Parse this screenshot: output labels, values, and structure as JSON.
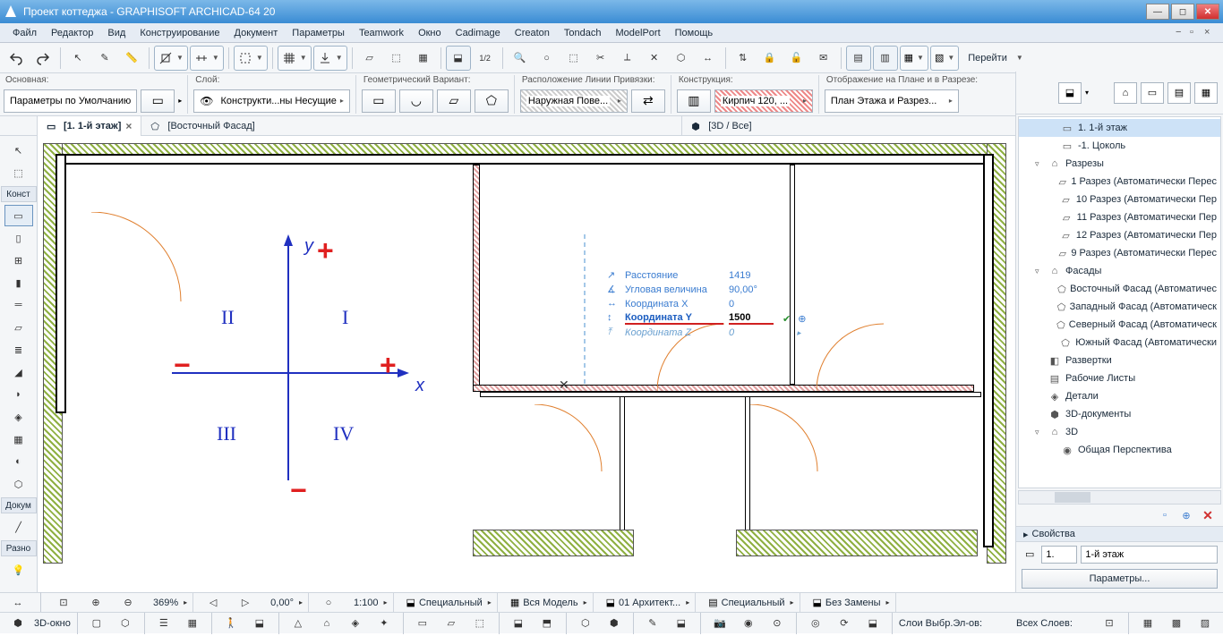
{
  "title": "Проект коттеджа - GRAPHISOFT ARCHICAD-64 20",
  "menu": [
    "Файл",
    "Редактор",
    "Вид",
    "Конструирование",
    "Документ",
    "Параметры",
    "Teamwork",
    "Окно",
    "Cadimage",
    "Creaton",
    "Tondach",
    "ModelPort",
    "Помощь"
  ],
  "go_label": "Перейти",
  "infobar": {
    "main": {
      "label": "Основная:",
      "value": "Параметры по Умолчанию"
    },
    "layer": {
      "label": "Слой:",
      "value": "Конструкти...ны Несущие"
    },
    "geom": {
      "label": "Геометрический Вариант:"
    },
    "snapline": {
      "label": "Расположение Линии Привязки:",
      "value": "Наружная Пове..."
    },
    "construct": {
      "label": "Конструкция:",
      "value": "Кирпич 120, ..."
    },
    "display": {
      "label": "Отображение на Плане и в Разрезе:",
      "value": "План Этажа и Разрез..."
    }
  },
  "tabs": [
    {
      "label": "[1. 1-й этаж]",
      "active": true,
      "icon": "plan-icon"
    },
    {
      "label": "[Восточный Фасад]",
      "active": false,
      "icon": "elev-icon"
    },
    {
      "label": "[3D / Все]",
      "active": false,
      "icon": "cube-icon"
    }
  ],
  "toolbox_groups": [
    "Конст",
    "Докум",
    "Разно"
  ],
  "canvas_labels": {
    "y": "y",
    "x": "x",
    "q1": "I",
    "q2": "II",
    "q3": "III",
    "q4": "IV"
  },
  "tracker": {
    "dist": {
      "label": "Расстояние",
      "val": "1419"
    },
    "ang": {
      "label": "Угловая величина",
      "val": "90,00°"
    },
    "cx": {
      "label": "Координата X",
      "val": "0"
    },
    "cy": {
      "label": "Координата Y",
      "val": "1500"
    },
    "cz": {
      "label": "Координата Z",
      "val": "0"
    }
  },
  "status1": {
    "zoom": "369%",
    "angle": "0,00°",
    "scale": "1:100",
    "spec1": "Специальный",
    "model": "Вся Модель",
    "arch": "01 Архитект...",
    "spec2": "Специальный",
    "nozam": "Без Замены"
  },
  "status2": {
    "win3d": "3D-окно",
    "layers_sel": "Слои Выбр.Эл-ов:",
    "layers_all": "Всех Слоев:"
  },
  "navigator": {
    "tree": [
      {
        "indent": 2,
        "icon": "floor",
        "label": "1. 1-й этаж",
        "sel": true
      },
      {
        "indent": 2,
        "icon": "floor",
        "label": "-1. Цоколь"
      },
      {
        "indent": 1,
        "icon": "folder",
        "label": "Разрезы",
        "toggle": "▿"
      },
      {
        "indent": 2,
        "icon": "sect",
        "label": "1 Разрез (Автоматически Перес"
      },
      {
        "indent": 2,
        "icon": "sect",
        "label": "10 Разрез (Автоматически Пер"
      },
      {
        "indent": 2,
        "icon": "sect",
        "label": "11 Разрез (Автоматически Пер"
      },
      {
        "indent": 2,
        "icon": "sect",
        "label": "12 Разрез (Автоматически Пер"
      },
      {
        "indent": 2,
        "icon": "sect",
        "label": "9 Разрез (Автоматически Перес"
      },
      {
        "indent": 1,
        "icon": "folder",
        "label": "Фасады",
        "toggle": "▿"
      },
      {
        "indent": 2,
        "icon": "elev",
        "label": "Восточный Фасад (Автоматичес"
      },
      {
        "indent": 2,
        "icon": "elev",
        "label": "Западный Фасад (Автоматическ"
      },
      {
        "indent": 2,
        "icon": "elev",
        "label": "Северный Фасад (Автоматическ"
      },
      {
        "indent": 2,
        "icon": "elev",
        "label": "Южный Фасад (Автоматически"
      },
      {
        "indent": 1,
        "icon": "rev",
        "label": "Развертки"
      },
      {
        "indent": 1,
        "icon": "work",
        "label": "Рабочие Листы"
      },
      {
        "indent": 1,
        "icon": "det",
        "label": "Детали"
      },
      {
        "indent": 1,
        "icon": "3dd",
        "label": "3D-документы"
      },
      {
        "indent": 1,
        "icon": "folder",
        "label": "3D",
        "toggle": "▿"
      },
      {
        "indent": 2,
        "icon": "persp",
        "label": "Общая Перспектива"
      }
    ],
    "props_title": "Свойства",
    "field1": "1.",
    "field2": "1-й этаж",
    "params_btn": "Параметры..."
  }
}
